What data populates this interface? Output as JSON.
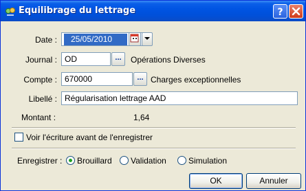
{
  "window": {
    "title": "Equilibrage du lettrage",
    "help": "?",
    "close": "×"
  },
  "form": {
    "date": {
      "label": "Date :",
      "value": "25/05/2010"
    },
    "journal": {
      "label": "Journal :",
      "value": "OD",
      "description": "Opérations Diverses",
      "lookup": "..."
    },
    "compte": {
      "label": "Compte :",
      "value": "670000",
      "description": "Charges exceptionnelles",
      "lookup": "..."
    },
    "libelle": {
      "label": "Libellé :",
      "value": "Régularisation lettrage AAD"
    },
    "montant": {
      "label": "Montant :",
      "value": "1,64"
    }
  },
  "options": {
    "preview_label": "Voir l'écriture avant de l'enregistrer",
    "preview_checked": false,
    "save_label": "Enregistrer :",
    "radios": [
      {
        "label": "Brouillard",
        "selected": true
      },
      {
        "label": "Validation",
        "selected": false
      },
      {
        "label": "Simulation",
        "selected": false
      }
    ]
  },
  "buttons": {
    "ok": "OK",
    "cancel": "Annuler"
  },
  "colors": {
    "titlebar": "#0054e3",
    "selection": "#316ac5",
    "radio_dot": "#21a121"
  }
}
